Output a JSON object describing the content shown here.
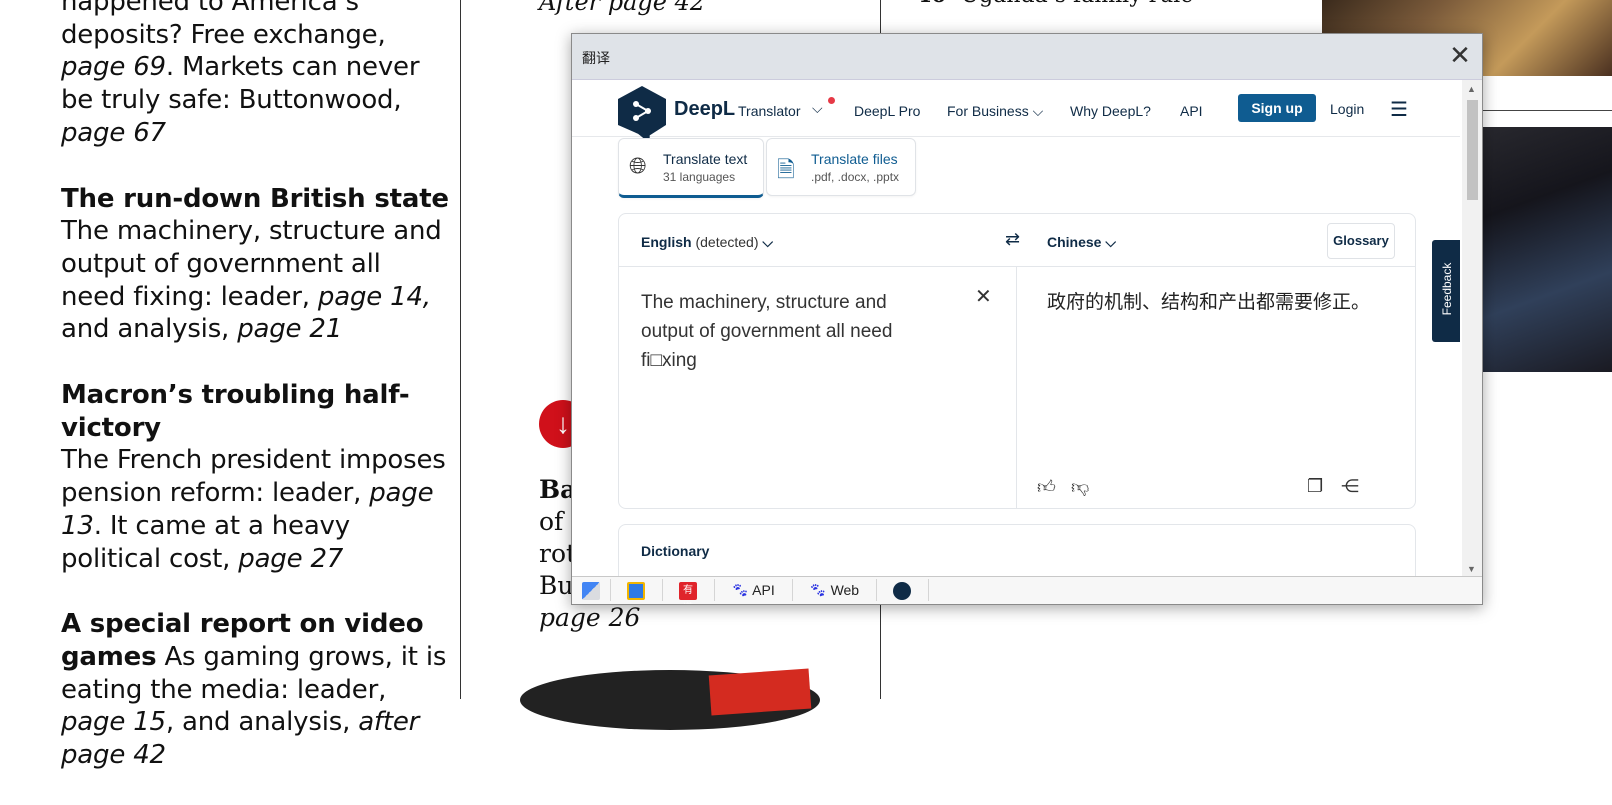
{
  "magazine": {
    "left_column": [
      {
        "title": "",
        "text_html": "happened to America’s deposits? Free exchange, <i>page 69</i>. Markets can never be truly safe: Buttonwood, <i>page 67</i>"
      },
      {
        "title": "The run-down British state",
        "text_html": "The machinery, structure and output of government all need fixing: leader, <i>page 14,</i> and analysis, <i>page 21</i>"
      },
      {
        "title": "Macron’s troubling half-victory",
        "text_html": "The French president imposes pension reform: leader, <i>page 13</i>. It came at a heavy political cost, <i>page 27</i>"
      },
      {
        "title": "A special report on video games",
        "text_html": "As gaming grows, it is eating the media: leader, <i>page 15</i>, and analysis, <i>after page 42</i>"
      }
    ],
    "middle_top": "After page 42",
    "middle_bottom_lines": [
      "Ba",
      "of",
      "rot",
      "Bu",
      "page 26"
    ],
    "right_top_number": "40",
    "right_top_text": "Uganda’s family rule"
  },
  "popup": {
    "title": "翻译",
    "close_label": "✕"
  },
  "deepl": {
    "brand": "DeepL",
    "brand_sub": "Translator",
    "nav": [
      "DeepL Pro",
      "For Business",
      "Why DeepL?",
      "API"
    ],
    "signup": "Sign up",
    "login": "Login",
    "tabs": [
      {
        "label": "Translate text",
        "sub": "31 languages"
      },
      {
        "label": "Translate files",
        "sub": ".pdf, .docx, .pptx"
      }
    ],
    "source_lang": "English",
    "source_lang_note": "(detected)",
    "target_lang": "Chinese",
    "glossary": "Glossary",
    "source_text": "The machinery, structure and output of government all need fi□xing",
    "target_text": "政府的机制、结构和产出都需要修正。",
    "dictionary": "Dictionary",
    "feedback": "Feedback"
  },
  "toolbar": {
    "items": [
      {
        "label": ""
      },
      {
        "label": ""
      },
      {
        "label": "有道"
      },
      {
        "label": "API"
      },
      {
        "label": "Web"
      },
      {
        "label": ""
      }
    ]
  },
  "colors": {
    "deepl_navy": "#0f2b46",
    "deepl_blue": "#0f5c91",
    "accent_red": "#d0101a"
  }
}
